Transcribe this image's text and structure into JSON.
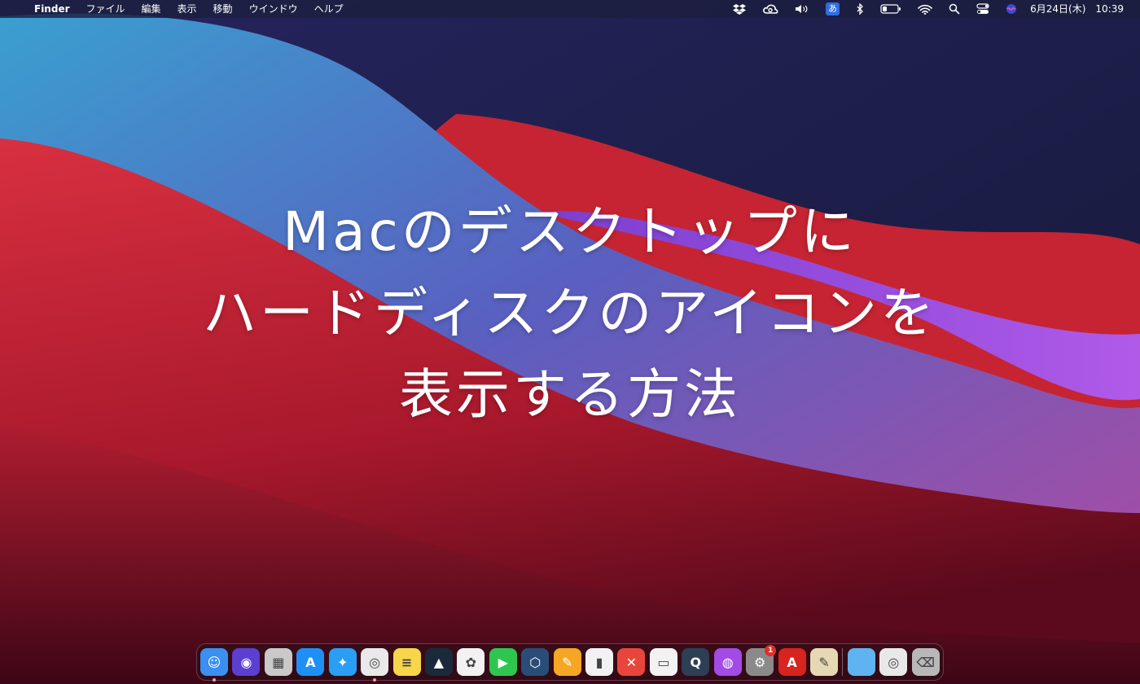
{
  "menubar": {
    "apple": "",
    "app_name": "Finder",
    "items": [
      "ファイル",
      "編集",
      "表示",
      "移動",
      "ウインドウ",
      "ヘルプ"
    ],
    "status": {
      "ime": "あ",
      "date": "6月24日(木)",
      "time": "10:39"
    }
  },
  "title": {
    "lines": [
      "Macのデスクトップに",
      "ハードディスクのアイコンを",
      "表示する方法"
    ]
  },
  "dock": {
    "apps": [
      {
        "name": "finder-icon",
        "glyph": "☺",
        "color": "#3b8ff0",
        "running": true
      },
      {
        "name": "siri-icon",
        "glyph": "◉",
        "color": "#5a3fd0",
        "running": false
      },
      {
        "name": "launchpad-icon",
        "glyph": "▦",
        "color": "#c9c9c9",
        "running": false
      },
      {
        "name": "app-store-icon",
        "glyph": "A",
        "color": "#1e8ff5",
        "running": false
      },
      {
        "name": "safari-icon",
        "glyph": "✦",
        "color": "#2a9df5",
        "running": false
      },
      {
        "name": "chrome-icon",
        "glyph": "◎",
        "color": "#e9e9e9",
        "running": true
      },
      {
        "name": "notes-icon",
        "glyph": "≡",
        "color": "#f7d64a",
        "running": false
      },
      {
        "name": "kindle-icon",
        "glyph": "▲",
        "color": "#1a2a3a",
        "running": false
      },
      {
        "name": "photos-icon",
        "glyph": "✿",
        "color": "#f2f2f2",
        "running": false
      },
      {
        "name": "facetime-icon",
        "glyph": "▶",
        "color": "#2fc650",
        "running": false
      },
      {
        "name": "transmit-icon",
        "glyph": "⬡",
        "color": "#2a4d78",
        "running": false
      },
      {
        "name": "pages-icon",
        "glyph": "✎",
        "color": "#f5a623",
        "running": false
      },
      {
        "name": "numbers-icon",
        "glyph": "▮",
        "color": "#f2f2f2",
        "running": false
      },
      {
        "name": "xmind-icon",
        "glyph": "✕",
        "color": "#e8453c",
        "running": false
      },
      {
        "name": "keynote-icon",
        "glyph": "▭",
        "color": "#f2f2f2",
        "running": false
      },
      {
        "name": "quicktime-icon",
        "glyph": "Q",
        "color": "#2d3f55",
        "running": false
      },
      {
        "name": "podcasts-icon",
        "glyph": "◍",
        "color": "#a24be6",
        "running": false
      },
      {
        "name": "system-preferences-icon",
        "glyph": "⚙",
        "color": "#8a8a8a",
        "running": false,
        "badge": "1"
      },
      {
        "name": "acrobat-icon",
        "glyph": "A",
        "color": "#d9231e",
        "running": false
      },
      {
        "name": "textedit-icon",
        "glyph": "✎",
        "color": "#e7d8b4",
        "running": false
      }
    ],
    "folders": [
      {
        "name": "folder-icon",
        "glyph": "",
        "color": "#5fb3f0"
      },
      {
        "name": "downloads-stack-icon",
        "glyph": "◎",
        "color": "#e8e8e8"
      },
      {
        "name": "trash-icon",
        "glyph": "⌫",
        "color": "#b8b8b8"
      }
    ]
  }
}
